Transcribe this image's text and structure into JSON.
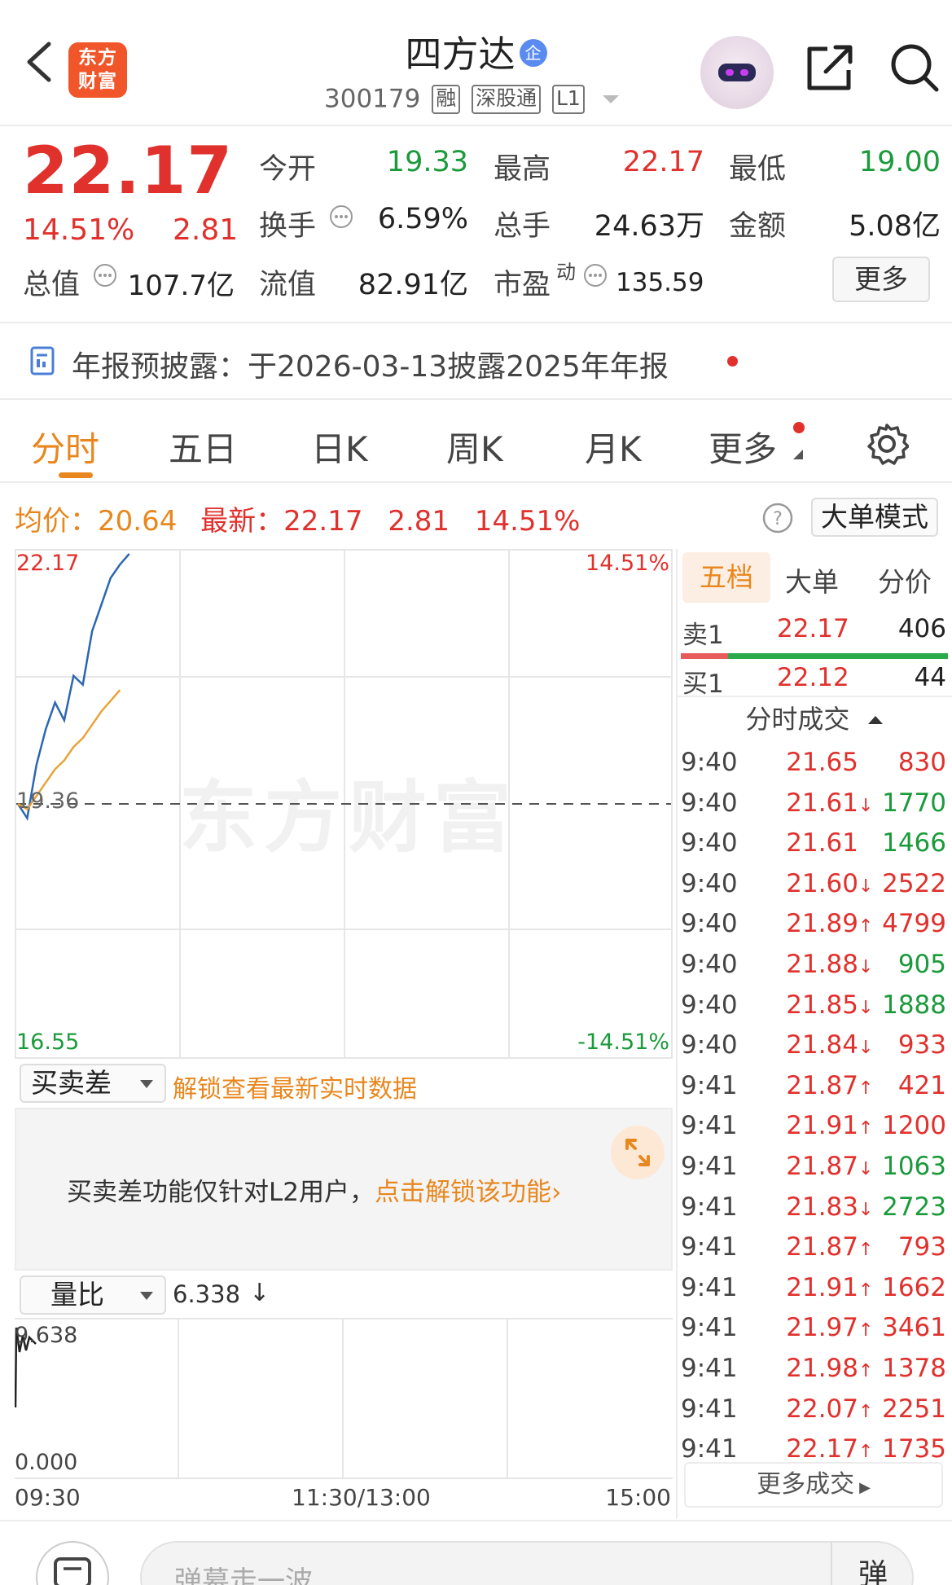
{
  "header": {
    "brand": "东方财富",
    "title": "四方达",
    "title_badge": "企",
    "code": "300179",
    "tags": [
      "融",
      "深股通",
      "L1"
    ]
  },
  "quote": {
    "price": "22.17",
    "change_pct": "14.51%",
    "change": "2.81",
    "open_label": "今开",
    "open": "19.33",
    "high_label": "最高",
    "high": "22.17",
    "low_label": "最低",
    "low": "19.00",
    "turnover_label": "换手",
    "turnover": "6.59%",
    "volume_label": "总手",
    "volume": "24.63万",
    "amount_label": "金额",
    "amount": "5.08亿",
    "mktcap_label": "总值",
    "mktcap": "107.7亿",
    "float_label": "流值",
    "float": "82.91亿",
    "pe_label": "市盈",
    "pe_sup": "动",
    "pe": "135.59",
    "more": "更多"
  },
  "notice": {
    "text": "年报预披露：于2026-03-13披露2025年年报"
  },
  "tabs": [
    "分时",
    "五日",
    "日K",
    "周K",
    "月K",
    "更多"
  ],
  "stats_bar": {
    "avg_label": "均价：",
    "avg": "20.64",
    "latest_label": "最新：",
    "latest": "22.17",
    "latest_change": "2.81",
    "latest_pct": "14.51%",
    "mode_button": "大单模式"
  },
  "chart": {
    "y_top": "22.17",
    "y_mid": "19.36",
    "y_bottom": "16.55",
    "pct_top": "14.51%",
    "pct_bottom": "-14.51%",
    "watermark": "东方财富",
    "x_labels": [
      "09:30",
      "11:30/13:00",
      "15:00"
    ]
  },
  "chart_data": {
    "type": "line",
    "title": "",
    "xlabel": "",
    "ylabel": "",
    "ylim": [
      16.55,
      22.17
    ],
    "baseline": 19.36,
    "x_ticks": [
      "09:30",
      "11:30/13:00",
      "15:00"
    ],
    "series": [
      {
        "values": [
          19.36,
          19.2,
          19.8,
          20.2,
          20.5,
          20.3,
          20.8,
          20.7,
          21.3,
          21.6,
          21.9,
          22.05,
          22.17
        ],
        "color": "#2b67b0"
      },
      {
        "values": [
          19.36,
          19.3,
          19.45,
          19.6,
          19.75,
          19.85,
          20.0,
          20.1,
          20.25,
          20.4,
          20.52,
          20.64
        ],
        "color": "#e8a33a"
      }
    ]
  },
  "buysell": {
    "dropdown": "买卖差",
    "unlock_hint": "解锁查看最新实时数据",
    "l2_text": "买卖差功能仅针对L2用户，",
    "l2_link": "点击解锁该功能"
  },
  "volratio": {
    "dropdown": "量比",
    "value": "6.338",
    "y_top": "9.638",
    "y_bottom": "0.000"
  },
  "orderbook": {
    "tabs": [
      "五档",
      "大单",
      "分价"
    ],
    "sell1": {
      "label": "卖1",
      "price": "22.17",
      "vol": "406"
    },
    "buy1": {
      "label": "买1",
      "price": "22.12",
      "vol": "44"
    },
    "trades_title": "分时成交",
    "trades": [
      {
        "t": "9:40",
        "p": "21.65",
        "d": "",
        "v": "830",
        "vc": "red"
      },
      {
        "t": "9:40",
        "p": "21.61",
        "d": "↓",
        "v": "1770",
        "vc": "green"
      },
      {
        "t": "9:40",
        "p": "21.61",
        "d": "",
        "v": "1466",
        "vc": "green"
      },
      {
        "t": "9:40",
        "p": "21.60",
        "d": "↓",
        "v": "2522",
        "vc": "red"
      },
      {
        "t": "9:40",
        "p": "21.89",
        "d": "↑",
        "v": "4799",
        "vc": "red"
      },
      {
        "t": "9:40",
        "p": "21.88",
        "d": "↓",
        "v": "905",
        "vc": "green"
      },
      {
        "t": "9:40",
        "p": "21.85",
        "d": "↓",
        "v": "1888",
        "vc": "green"
      },
      {
        "t": "9:40",
        "p": "21.84",
        "d": "↓",
        "v": "933",
        "vc": "red"
      },
      {
        "t": "9:41",
        "p": "21.87",
        "d": "↑",
        "v": "421",
        "vc": "red"
      },
      {
        "t": "9:41",
        "p": "21.91",
        "d": "↑",
        "v": "1200",
        "vc": "red"
      },
      {
        "t": "9:41",
        "p": "21.87",
        "d": "↓",
        "v": "1063",
        "vc": "green"
      },
      {
        "t": "9:41",
        "p": "21.83",
        "d": "↓",
        "v": "2723",
        "vc": "green"
      },
      {
        "t": "9:41",
        "p": "21.87",
        "d": "↑",
        "v": "793",
        "vc": "red"
      },
      {
        "t": "9:41",
        "p": "21.91",
        "d": "↑",
        "v": "1662",
        "vc": "red"
      },
      {
        "t": "9:41",
        "p": "21.97",
        "d": "↑",
        "v": "3461",
        "vc": "red"
      },
      {
        "t": "9:41",
        "p": "21.98",
        "d": "↑",
        "v": "1378",
        "vc": "red"
      },
      {
        "t": "9:41",
        "p": "22.07",
        "d": "↑",
        "v": "2251",
        "vc": "red"
      },
      {
        "t": "9:41",
        "p": "22.17",
        "d": "↑",
        "v": "1735",
        "vc": "red"
      }
    ],
    "more_trades": "更多成交"
  },
  "bottom": {
    "danmu_placeholder": "弹幕走一波...",
    "danmu_button": "弹"
  }
}
